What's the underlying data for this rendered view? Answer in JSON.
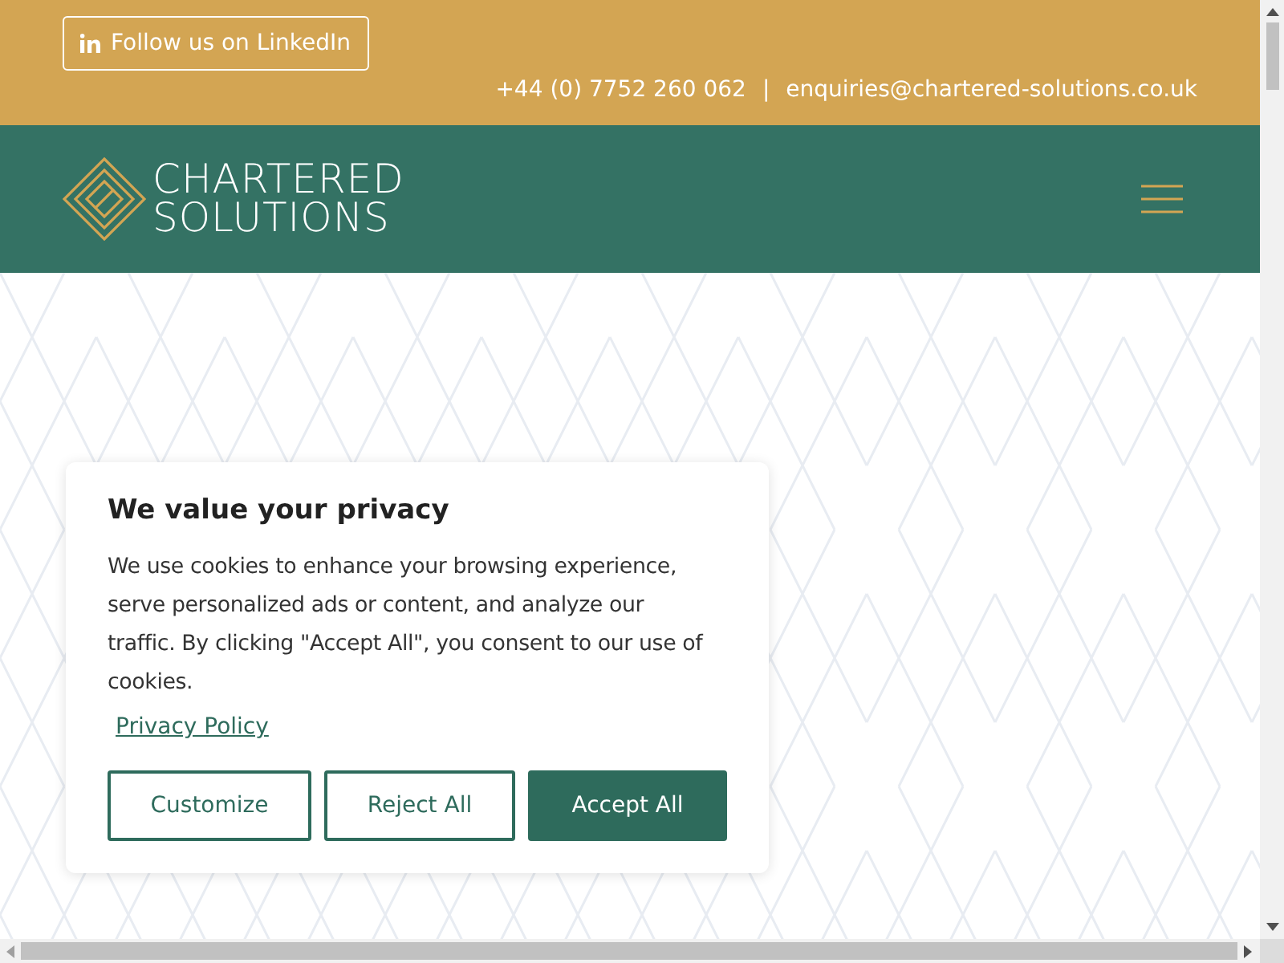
{
  "top_bar": {
    "linkedin_button": "Follow us on LinkedIn",
    "phone": "+44 (0) 7752 260 062",
    "separator": "|",
    "email": "enquiries@chartered-solutions.co.uk"
  },
  "header": {
    "logo_lines": [
      "CHARTERED",
      "SOLUTIONS"
    ]
  },
  "cookie_banner": {
    "title": "We value your privacy",
    "body": "We use cookies to enhance your browsing experience, serve personalized ads or content, and analyze our traffic. By clicking \"Accept All\", you consent to our use of cookies.",
    "link": "Privacy Policy",
    "buttons": [
      {
        "label": "Customize",
        "kind": "outline"
      },
      {
        "label": "Reject All",
        "kind": "outline"
      },
      {
        "label": "Accept All",
        "kind": "primary"
      }
    ]
  }
}
